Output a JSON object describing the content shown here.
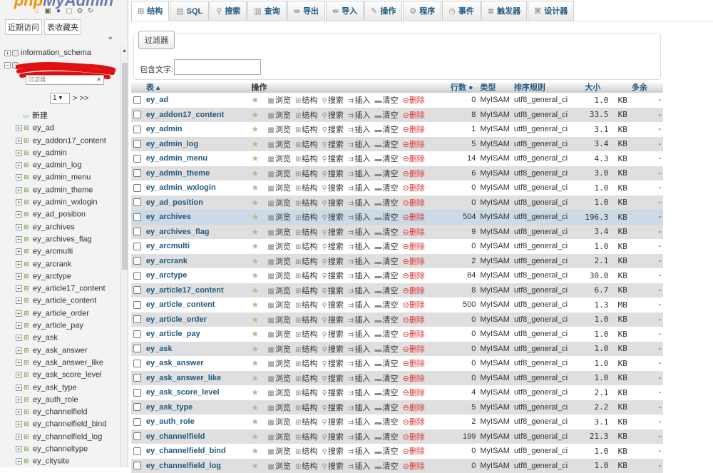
{
  "sidebar": {
    "logo_part1": "php",
    "logo_part2": "MyAdmin",
    "tabs": [
      "近期访问",
      "表收藏夹"
    ],
    "databases": [
      {
        "name": "information_schema"
      }
    ],
    "filter_placeholder": "过滤器",
    "pager_value": "1",
    "pager_next": "> >>",
    "new_label": "新建",
    "tables": [
      "ey_ad",
      "ey_addon17_content",
      "ey_admin",
      "ey_admin_log",
      "ey_admin_menu",
      "ey_admin_theme",
      "ey_admin_wxlogin",
      "ey_ad_position",
      "ey_archives",
      "ey_archives_flag",
      "ey_arcmulti",
      "ey_arcrank",
      "ey_arctype",
      "ey_article17_content",
      "ey_article_content",
      "ey_article_order",
      "ey_article_pay",
      "ey_ask",
      "ey_ask_answer",
      "ey_ask_answer_like",
      "ey_ask_score_level",
      "ey_ask_type",
      "ey_auth_role",
      "ey_channelfield",
      "ey_channelfield_bind",
      "ey_channelfield_log",
      "ey_channeltype",
      "ey_citysite"
    ]
  },
  "topnav": [
    {
      "label": "结构",
      "icon": "structure-icon"
    },
    {
      "label": "SQL",
      "icon": "sql-icon"
    },
    {
      "label": "搜索",
      "icon": "search-icon"
    },
    {
      "label": "查询",
      "icon": "query-icon"
    },
    {
      "label": "导出",
      "icon": "export-icon"
    },
    {
      "label": "导入",
      "icon": "import-icon"
    },
    {
      "label": "操作",
      "icon": "operations-icon"
    },
    {
      "label": "程序",
      "icon": "routines-icon"
    },
    {
      "label": "事件",
      "icon": "events-icon"
    },
    {
      "label": "触发器",
      "icon": "triggers-icon"
    },
    {
      "label": "设计器",
      "icon": "designer-icon"
    }
  ],
  "filter": {
    "legend": "过滤器",
    "label": "包含文字:"
  },
  "table": {
    "headers": {
      "table": "表",
      "action": "操作",
      "rows": "行数",
      "type": "类型",
      "collation": "排序规则",
      "size": "大小",
      "overhead": "多余"
    },
    "actions": {
      "browse": "浏览",
      "structure": "结构",
      "search": "搜索",
      "insert": "插入",
      "empty": "清空",
      "drop": "删除"
    },
    "rows": [
      {
        "name": "ey_ad",
        "rows": "0",
        "type": "MyISAM",
        "collation": "utf8_general_ci",
        "size": "1.0",
        "unit": "KB",
        "overhead": "-"
      },
      {
        "name": "ey_addon17_content",
        "rows": "8",
        "type": "MyISAM",
        "collation": "utf8_general_ci",
        "size": "33.5",
        "unit": "KB",
        "overhead": "-"
      },
      {
        "name": "ey_admin",
        "rows": "1",
        "type": "MyISAM",
        "collation": "utf8_general_ci",
        "size": "3.1",
        "unit": "KB",
        "overhead": "-"
      },
      {
        "name": "ey_admin_log",
        "rows": "5",
        "type": "MyISAM",
        "collation": "utf8_general_ci",
        "size": "3.4",
        "unit": "KB",
        "overhead": "-"
      },
      {
        "name": "ey_admin_menu",
        "rows": "14",
        "type": "MyISAM",
        "collation": "utf8_general_ci",
        "size": "4.3",
        "unit": "KB",
        "overhead": "-"
      },
      {
        "name": "ey_admin_theme",
        "rows": "6",
        "type": "MyISAM",
        "collation": "utf8_general_ci",
        "size": "3.0",
        "unit": "KB",
        "overhead": "-"
      },
      {
        "name": "ey_admin_wxlogin",
        "rows": "0",
        "type": "MyISAM",
        "collation": "utf8_general_ci",
        "size": "1.0",
        "unit": "KB",
        "overhead": "-"
      },
      {
        "name": "ey_ad_position",
        "rows": "0",
        "type": "MyISAM",
        "collation": "utf8_general_ci",
        "size": "1.0",
        "unit": "KB",
        "overhead": "-"
      },
      {
        "name": "ey_archives",
        "rows": "504",
        "type": "MyISAM",
        "collation": "utf8_general_ci",
        "size": "196.3",
        "unit": "KB",
        "overhead": "-"
      },
      {
        "name": "ey_archives_flag",
        "rows": "9",
        "type": "MyISAM",
        "collation": "utf8_general_ci",
        "size": "3.4",
        "unit": "KB",
        "overhead": "-"
      },
      {
        "name": "ey_arcmulti",
        "rows": "0",
        "type": "MyISAM",
        "collation": "utf8_general_ci",
        "size": "1.0",
        "unit": "KB",
        "overhead": "-"
      },
      {
        "name": "ey_arcrank",
        "rows": "2",
        "type": "MyISAM",
        "collation": "utf8_general_ci",
        "size": "2.1",
        "unit": "KB",
        "overhead": "-"
      },
      {
        "name": "ey_arctype",
        "rows": "84",
        "type": "MyISAM",
        "collation": "utf8_general_ci",
        "size": "30.0",
        "unit": "KB",
        "overhead": "-"
      },
      {
        "name": "ey_article17_content",
        "rows": "8",
        "type": "MyISAM",
        "collation": "utf8_general_ci",
        "size": "6.7",
        "unit": "KB",
        "overhead": "-"
      },
      {
        "name": "ey_article_content",
        "rows": "500",
        "type": "MyISAM",
        "collation": "utf8_general_ci",
        "size": "1.3",
        "unit": "MB",
        "overhead": "-"
      },
      {
        "name": "ey_article_order",
        "rows": "0",
        "type": "MyISAM",
        "collation": "utf8_general_ci",
        "size": "1.0",
        "unit": "KB",
        "overhead": "-"
      },
      {
        "name": "ey_article_pay",
        "rows": "0",
        "type": "MyISAM",
        "collation": "utf8_general_ci",
        "size": "1.0",
        "unit": "KB",
        "overhead": "-"
      },
      {
        "name": "ey_ask",
        "rows": "0",
        "type": "MyISAM",
        "collation": "utf8_general_ci",
        "size": "1.0",
        "unit": "KB",
        "overhead": "-"
      },
      {
        "name": "ey_ask_answer",
        "rows": "0",
        "type": "MyISAM",
        "collation": "utf8_general_ci",
        "size": "1.0",
        "unit": "KB",
        "overhead": "-"
      },
      {
        "name": "ey_ask_answer_like",
        "rows": "0",
        "type": "MyISAM",
        "collation": "utf8_general_ci",
        "size": "1.0",
        "unit": "KB",
        "overhead": "-"
      },
      {
        "name": "ey_ask_score_level",
        "rows": "4",
        "type": "MyISAM",
        "collation": "utf8_general_ci",
        "size": "2.1",
        "unit": "KB",
        "overhead": "-"
      },
      {
        "name": "ey_ask_type",
        "rows": "5",
        "type": "MyISAM",
        "collation": "utf8_general_ci",
        "size": "2.2",
        "unit": "KB",
        "overhead": "-"
      },
      {
        "name": "ey_auth_role",
        "rows": "2",
        "type": "MyISAM",
        "collation": "utf8_general_ci",
        "size": "3.1",
        "unit": "KB",
        "overhead": "-"
      },
      {
        "name": "ey_channelfield",
        "rows": "199",
        "type": "MyISAM",
        "collation": "utf8_general_ci",
        "size": "21.3",
        "unit": "KB",
        "overhead": "-"
      },
      {
        "name": "ey_channelfield_bind",
        "rows": "0",
        "type": "MyISAM",
        "collation": "utf8_general_ci",
        "size": "1.0",
        "unit": "KB",
        "overhead": "-"
      },
      {
        "name": "ey_channelfield_log",
        "rows": "0",
        "type": "MyISAM",
        "collation": "utf8_general_ci",
        "size": "1.0",
        "unit": "KB",
        "overhead": "-"
      }
    ]
  },
  "colors": {
    "link": "#235a81",
    "highlight_row": "#ccd9e6",
    "even_row": "#dfdfdf",
    "drop": "#dd3333",
    "logo_orange": "#f29100",
    "logo_blue": "#6c78af"
  }
}
